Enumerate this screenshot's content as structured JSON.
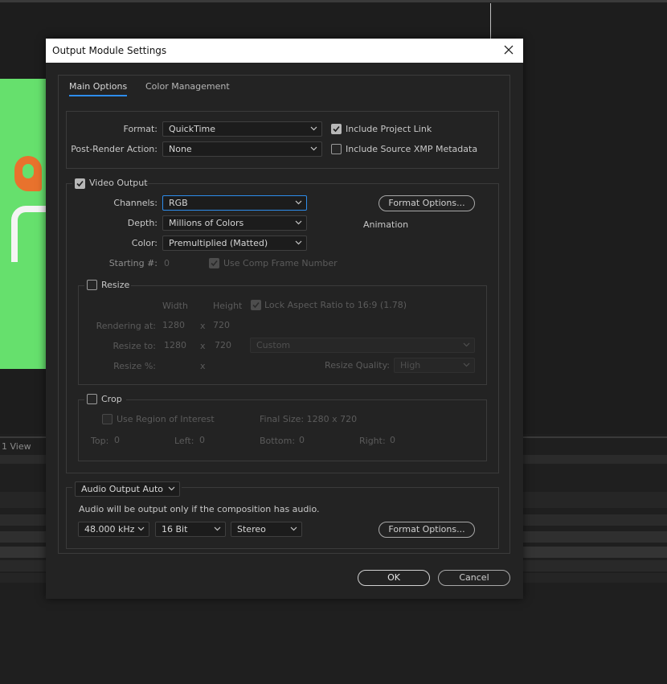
{
  "background": {
    "view_label": "1 View"
  },
  "dialog": {
    "title": "Output Module Settings",
    "tabs": {
      "main": "Main Options",
      "color": "Color Management"
    },
    "format": {
      "label": "Format:",
      "value": "QuickTime"
    },
    "post_render": {
      "label": "Post-Render Action:",
      "value": "None"
    },
    "include_project_link": {
      "label": "Include Project Link",
      "checked": true
    },
    "include_xmp": {
      "label": "Include Source XMP Metadata",
      "checked": false
    },
    "video": {
      "label": "Video Output",
      "checked": true,
      "channels": {
        "label": "Channels:",
        "value": "RGB"
      },
      "depth": {
        "label": "Depth:",
        "value": "Millions of Colors"
      },
      "color": {
        "label": "Color:",
        "value": "Premultiplied (Matted)"
      },
      "format_options": "Format Options...",
      "codec": "Animation",
      "starting": {
        "label": "Starting #:",
        "value": "0"
      },
      "use_comp_frame": "Use Comp Frame Number"
    },
    "resize": {
      "label": "Resize",
      "width_header": "Width",
      "height_header": "Height",
      "lock_aspect": "Lock Aspect Ratio to 16:9 (1.78)",
      "rendering_at": {
        "label": "Rendering at:",
        "w": "1280",
        "x": "x",
        "h": "720"
      },
      "resize_to": {
        "label": "Resize to:",
        "w": "1280",
        "x": "x",
        "h": "720",
        "preset": "Custom"
      },
      "resize_pct": {
        "label": "Resize %:",
        "x": "x"
      },
      "quality": {
        "label": "Resize Quality:",
        "value": "High"
      }
    },
    "crop": {
      "label": "Crop",
      "use_roi": "Use Region of Interest",
      "final_size": "Final Size: 1280 x 720",
      "top": {
        "label": "Top:",
        "value": "0"
      },
      "left": {
        "label": "Left:",
        "value": "0"
      },
      "bottom": {
        "label": "Bottom:",
        "value": "0"
      },
      "right": {
        "label": "Right:",
        "value": "0"
      }
    },
    "audio": {
      "mode": "Audio Output Auto",
      "note": "Audio will be output only if the composition has audio.",
      "rate": "48.000 kHz",
      "bits": "16 Bit",
      "channels": "Stereo",
      "format_options": "Format Options..."
    },
    "ok": "OK",
    "cancel": "Cancel"
  }
}
